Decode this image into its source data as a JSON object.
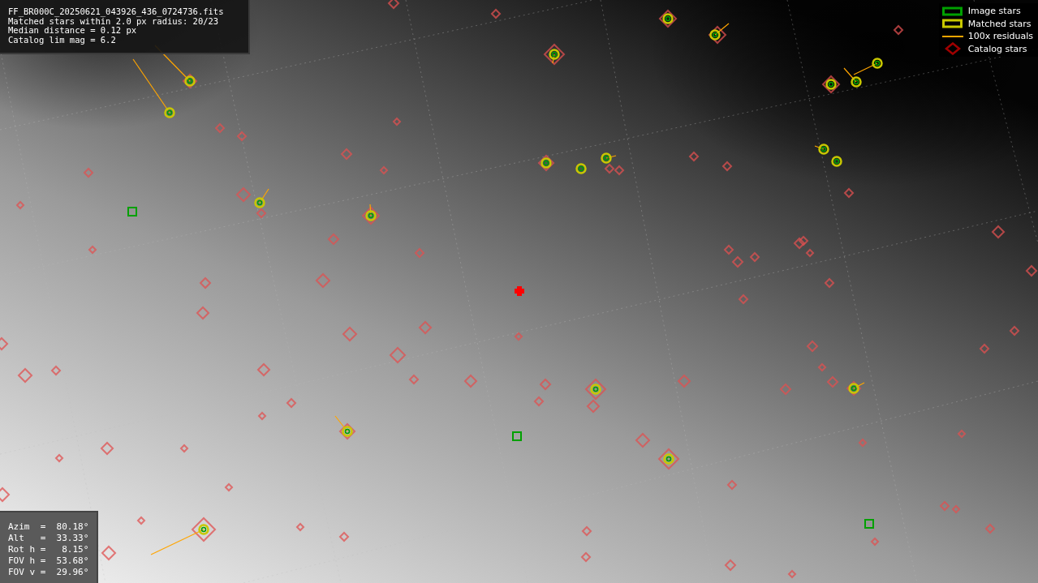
{
  "info": {
    "lines": [
      "FF_BR000C_20250621_043926_436_0724736.fits",
      "Matched stars within 2.0 px radius: 20/23",
      "Median distance = 0.12 px",
      "Catalog lim mag = 6.2"
    ]
  },
  "legend": [
    {
      "label": "Image stars",
      "kind": "box",
      "color": "#00a000"
    },
    {
      "label": "Matched stars",
      "kind": "box",
      "color": "#c8c800"
    },
    {
      "label": "100x residuals",
      "kind": "line",
      "color": "#ffa500"
    },
    {
      "label": "Catalog stars",
      "kind": "diamond",
      "color": "#a00000"
    }
  ],
  "pointing": {
    "lines": [
      "Azim  =  80.18°",
      "Alt   =  33.33°",
      "Rot h =   8.15°",
      "FOV h =  53.68°",
      "FOV v =  29.96°"
    ]
  }
}
